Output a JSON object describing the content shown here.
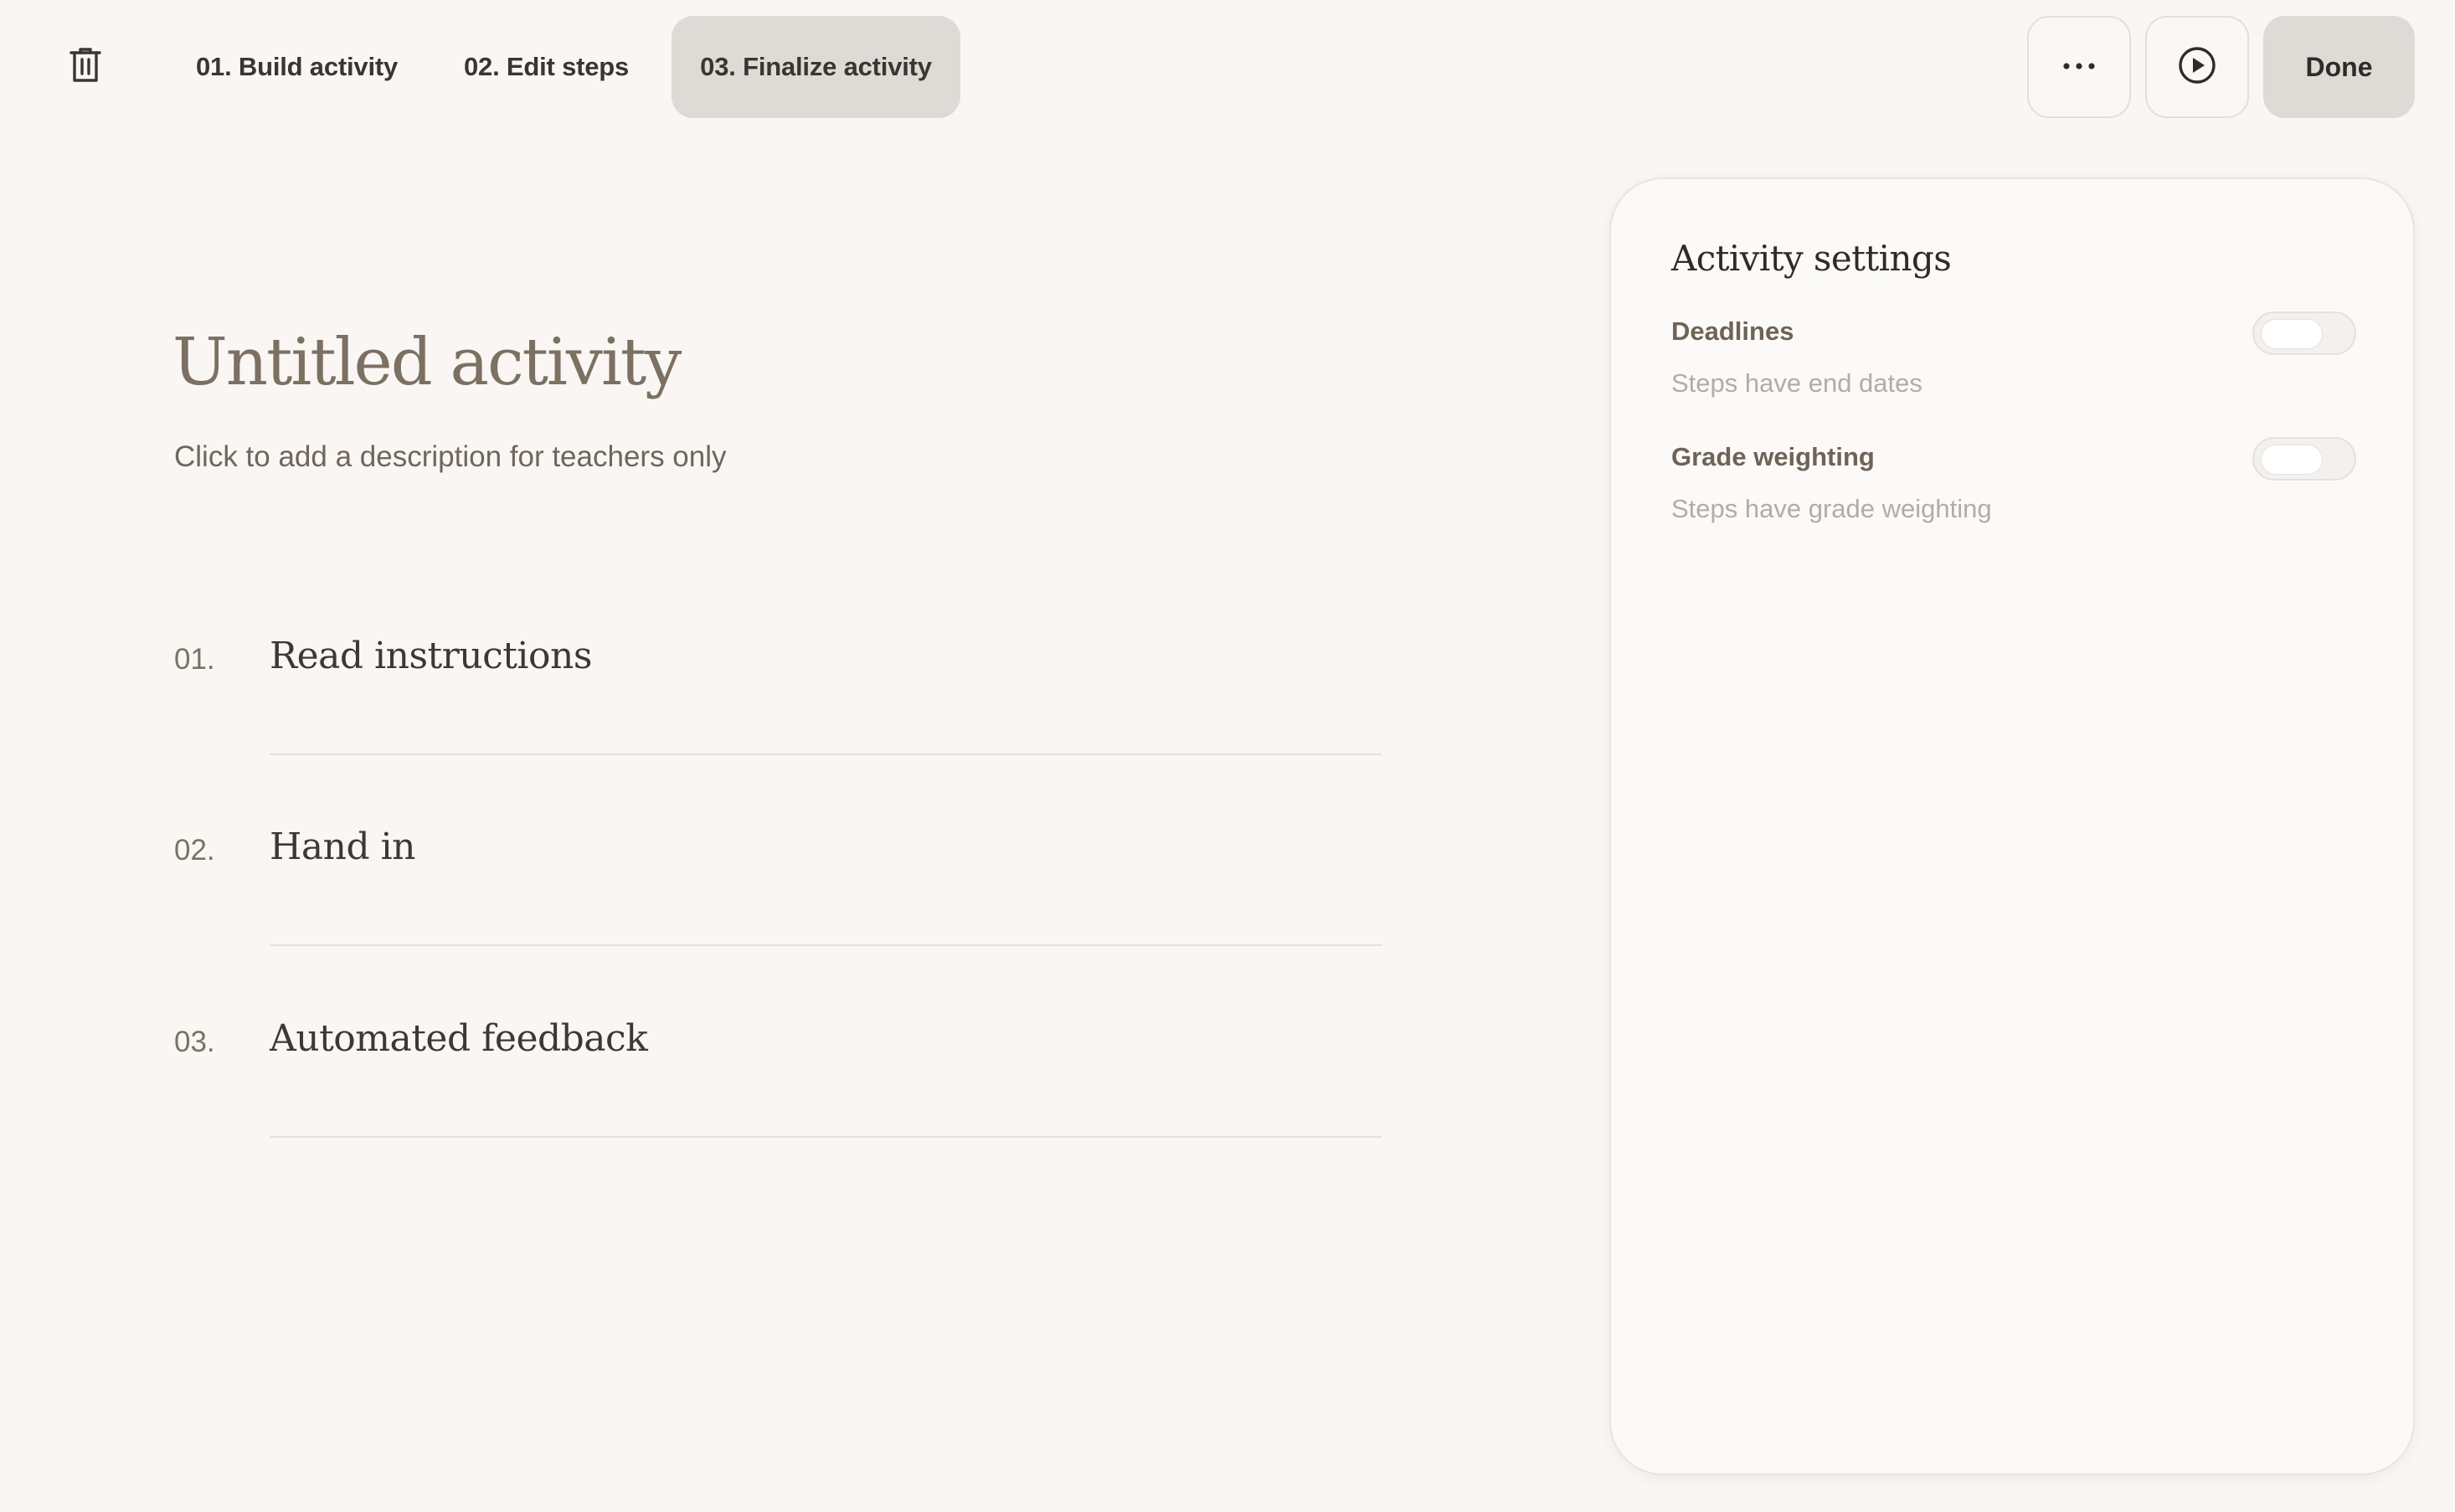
{
  "toolbar": {
    "delete_icon": "trash-icon",
    "tabs": [
      {
        "label": "01. Build activity",
        "active": false
      },
      {
        "label": "02. Edit steps",
        "active": false
      },
      {
        "label": "03. Finalize activity",
        "active": true
      }
    ],
    "more_icon": "more-horizontal-icon",
    "preview_icon": "play-circle-icon",
    "done_label": "Done"
  },
  "activity": {
    "title": "Untitled activity",
    "description_placeholder": "Click to add a description for teachers only"
  },
  "steps": [
    {
      "number": "01.",
      "title": "Read instructions"
    },
    {
      "number": "02.",
      "title": "Hand in"
    },
    {
      "number": "03.",
      "title": "Automated feedback"
    }
  ],
  "settings": {
    "title": "Activity settings",
    "items": [
      {
        "label": "Deadlines",
        "description": "Steps have end dates",
        "enabled": false
      },
      {
        "label": "Grade weighting",
        "description": "Steps have grade weighting",
        "enabled": false
      }
    ]
  },
  "colors": {
    "background": "#f9f6f3",
    "active_tab": "#dedad6",
    "title_text": "#7b7062"
  }
}
